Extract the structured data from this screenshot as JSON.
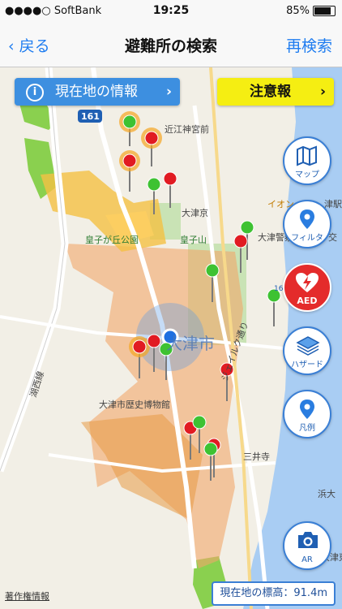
{
  "status_bar": {
    "carrier": "●●●●○ SoftBank",
    "time": "19:25",
    "battery": "85%"
  },
  "nav": {
    "back_label": "戻る",
    "title": "避難所の検索",
    "research_label": "再検索"
  },
  "buttons": {
    "current_info": "現在地の情報",
    "warning": "注意報",
    "map": "マップ",
    "filter": "フィルタ",
    "aed": "AED",
    "hazard": "ハザード",
    "legend": "凡例",
    "ar": "AR"
  },
  "map_labels": {
    "route": "161",
    "route2": "161",
    "shrine": "近江神宮前",
    "station1": "大津京",
    "park": "皇子が丘公園",
    "station2": "皇子山",
    "city": "大津市",
    "police": "大津警察",
    "aeon": "イオン",
    "museum": "大津市歴史博物館",
    "temple": "三井寺",
    "lake_road": "湖西線",
    "road2": "ジェイルク通り",
    "east": "浜大",
    "area_br": "大津東山",
    "area_r": "交",
    "station_r": "津駅"
  },
  "copyright": "著作権情報",
  "elevation": "現在地の標高：91.4m",
  "colors": {
    "accent": "#3a7fd5",
    "warning": "#f5ee12",
    "aed": "#e42b2b"
  }
}
